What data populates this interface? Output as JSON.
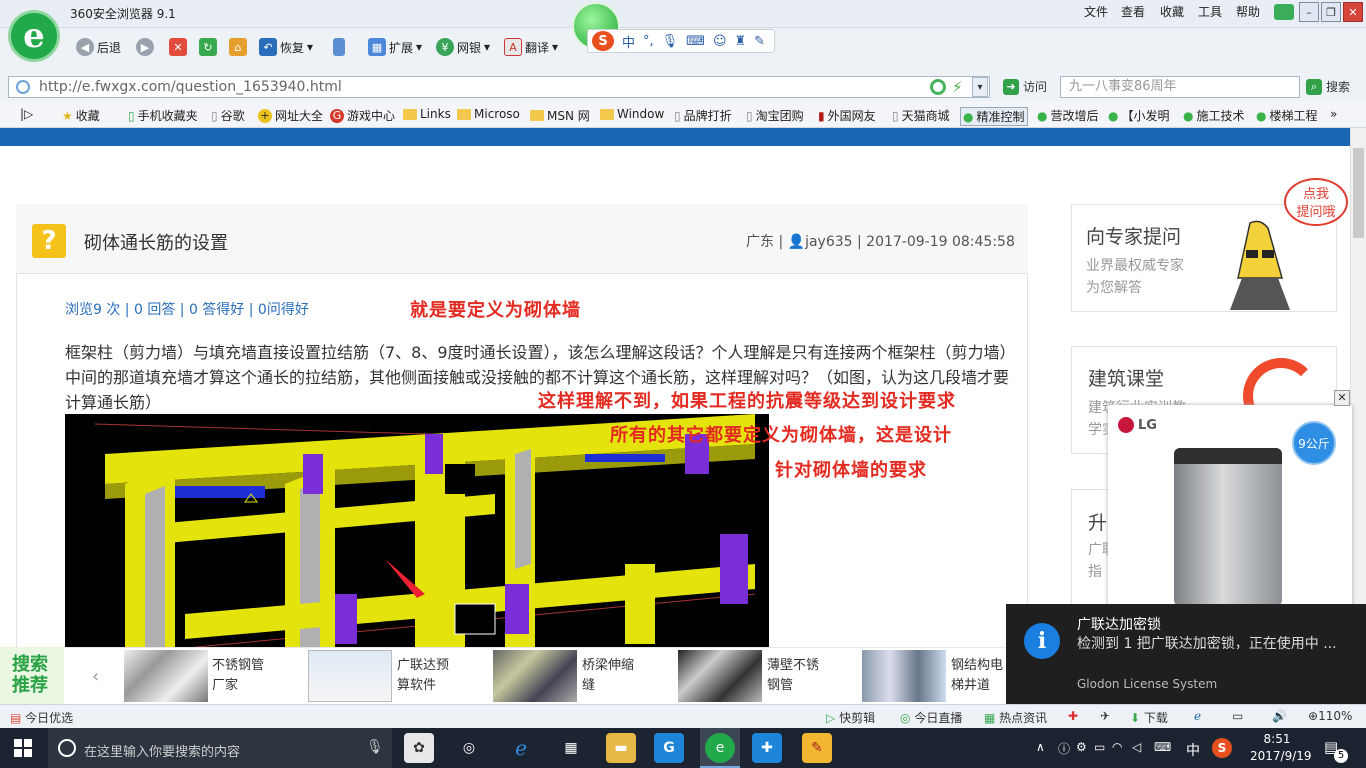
{
  "browser": {
    "title": "360安全浏览器 9.1",
    "menu": [
      "文件",
      "查看",
      "收藏",
      "工具",
      "帮助"
    ],
    "logo": "e"
  },
  "toolbar": {
    "back": "后退",
    "restore": "恢复",
    "extend": "扩展",
    "bank": "网银",
    "translate": "翻译"
  },
  "ime": {
    "label": "中",
    "punct": "°,"
  },
  "address": {
    "url": "http://e.fwxgx.com/question_1653940.html",
    "go": "访问",
    "search_placeholder": "九一八事变86周年",
    "search": "搜索"
  },
  "bookmarks": [
    "收藏",
    "手机收藏夹",
    "谷歌",
    "网址大全",
    "游戏中心",
    "Links",
    "Microso",
    "MSN 网",
    "Window",
    "品牌打折",
    "淘宝团购",
    "外国网友",
    "天猫商城",
    "精准控制",
    "营改增后",
    "【小发明",
    "施工技术",
    "楼梯工程"
  ],
  "question": {
    "icon": "?",
    "title": "砌体通长筋的设置",
    "meta": "广东 | ",
    "user": "jay635",
    "meta2": " | 2017-09-19 08:45:58",
    "stats": "浏览9 次 | 0 回答 | 0 答得好 | 0问得好",
    "body": "框架柱（剪力墙）与填充墙直接设置拉结筋（7、8、9度时通长设置），该怎么理解这段话？个人理解是只有连接两个框架柱（剪力墙）中间的那道填充墙才算这个通长的拉结筋，其他侧面接触或没接触的都不计算这个通长筋，这样理解对吗？（如图，认为这几段墙才要计算通长筋）"
  },
  "annotations": [
    "就是要定义为砌体墙",
    "这样理解不到，如果工程的抗震等级达到设计要求",
    "所有的其它都要定义为砌体墙，这是设计",
    "针对砌体墙的要求"
  ],
  "sidebar": {
    "expert_title": "向专家提问",
    "expert_sub1": "业界最权威专家",
    "expert_sub2": "为您解答",
    "bubble": "点我\n提问哦",
    "class_title": "建筑课堂",
    "class_sub1": "建筑行业实训教",
    "class_sub2": "学实践",
    "third_title": "升",
    "third_sub1": "广联",
    "third_sub2": "指"
  },
  "ad": {
    "brand": "LG",
    "badge": "9公斤"
  },
  "search_rec": {
    "label": "搜索\n推荐",
    "items": [
      {
        "l1": "不锈钢管",
        "l2": "厂家"
      },
      {
        "l1": "广联达预",
        "l2": "算软件"
      },
      {
        "l1": "桥梁伸缩",
        "l2": "缝"
      },
      {
        "l1": "薄壁不锈",
        "l2": "钢管"
      },
      {
        "l1": "钢结构电",
        "l2": "梯井道"
      }
    ]
  },
  "notification": {
    "title": "广联达加密锁",
    "body": "检测到 1 把广联达加密锁，正在使用中 ...",
    "source": "Glodon License System"
  },
  "statusbar": {
    "left": "今日优选",
    "items": [
      "快剪辑",
      "今日直播",
      "热点资讯",
      "下载"
    ],
    "zoom": "110%"
  },
  "taskbar": {
    "search": "在这里输入你要搜索的内容",
    "time": "8:51",
    "date": "2017/9/19",
    "ime": "中",
    "badge": "5"
  },
  "colors": {
    "accent": "#1a66b3",
    "annotation": "#e32b21",
    "logo": "#22a94a"
  }
}
